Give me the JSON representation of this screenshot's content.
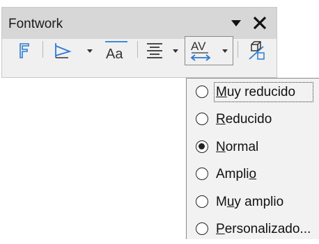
{
  "toolbar": {
    "title": "Fontwork",
    "buttons": [
      {
        "name": "fontwork-gallery",
        "icon": "fontwork-f-icon"
      },
      {
        "name": "fontwork-shape",
        "icon": "fontwork-shape-icon"
      },
      {
        "name": "same-letter-heights",
        "icon": "same-letter-heights-icon",
        "text": "Aa"
      },
      {
        "name": "fontwork-alignment",
        "icon": "align-center-icon"
      },
      {
        "name": "character-spacing",
        "icon": "character-spacing-icon",
        "text": "AV"
      },
      {
        "name": "toggle-extrusion",
        "icon": "toggle-extrusion-icon"
      }
    ]
  },
  "spacing_menu": {
    "items": [
      {
        "pre": "",
        "key": "M",
        "post": "uy reducido",
        "checked": false
      },
      {
        "pre": "",
        "key": "R",
        "post": "educido",
        "checked": false
      },
      {
        "pre": "",
        "key": "N",
        "post": "ormal",
        "checked": true
      },
      {
        "pre": "Ampli",
        "key": "o",
        "post": "",
        "checked": false
      },
      {
        "pre": "M",
        "key": "u",
        "post": "y amplio",
        "checked": false
      },
      {
        "pre": "",
        "key": "P",
        "post": "ersonalizado...",
        "checked": false
      }
    ]
  },
  "colors": {
    "accent": "#2a7bd1",
    "titlebar": "#d7d7d7",
    "panel": "#f0f0f0"
  }
}
